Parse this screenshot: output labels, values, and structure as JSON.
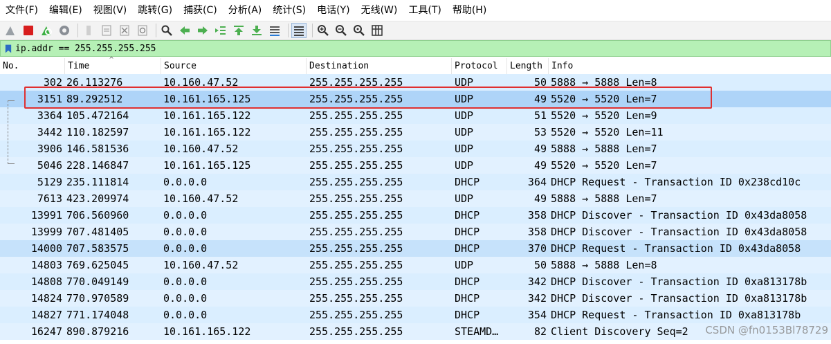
{
  "menu": [
    "文件(F)",
    "编辑(E)",
    "视图(V)",
    "跳转(G)",
    "捕获(C)",
    "分析(A)",
    "统计(S)",
    "电话(Y)",
    "无线(W)",
    "工具(T)",
    "帮助(H)"
  ],
  "toolbar": {
    "icons": [
      "shark-fin-start-icon",
      "stop-capture-icon",
      "restart-capture-icon",
      "capture-options-icon",
      "open-file-icon",
      "save-file-icon",
      "close-file-icon",
      "reload-file-icon",
      "find-packet-icon",
      "go-back-icon",
      "go-forward-icon",
      "go-to-packet-icon",
      "go-first-icon",
      "go-last-icon",
      "auto-scroll-icon",
      "colorize-icon",
      "zoom-in-icon",
      "zoom-out-icon",
      "zoom-normal-icon",
      "resize-columns-icon"
    ]
  },
  "filter": {
    "value": "ip.addr == 255.255.255.255",
    "background": "#b6f0b6"
  },
  "columns": [
    "No.",
    "Time",
    "Source",
    "Destination",
    "Protocol",
    "Length",
    "Info"
  ],
  "packets": [
    {
      "no": "302",
      "time": "26.113276",
      "src": "10.160.47.52",
      "dst": "255.255.255.255",
      "proto": "UDP",
      "len": "50",
      "info": "5888 → 5888 Len=8"
    },
    {
      "no": "3151",
      "time": "89.292512",
      "src": "10.161.165.125",
      "dst": "255.255.255.255",
      "proto": "UDP",
      "len": "49",
      "info": "5520 → 5520 Len=7"
    },
    {
      "no": "3364",
      "time": "105.472164",
      "src": "10.161.165.122",
      "dst": "255.255.255.255",
      "proto": "UDP",
      "len": "51",
      "info": "5520 → 5520 Len=9"
    },
    {
      "no": "3442",
      "time": "110.182597",
      "src": "10.161.165.122",
      "dst": "255.255.255.255",
      "proto": "UDP",
      "len": "53",
      "info": "5520 → 5520 Len=11"
    },
    {
      "no": "3906",
      "time": "146.581536",
      "src": "10.160.47.52",
      "dst": "255.255.255.255",
      "proto": "UDP",
      "len": "49",
      "info": "5888 → 5888 Len=7"
    },
    {
      "no": "5046",
      "time": "228.146847",
      "src": "10.161.165.125",
      "dst": "255.255.255.255",
      "proto": "UDP",
      "len": "49",
      "info": "5520 → 5520 Len=7"
    },
    {
      "no": "5129",
      "time": "235.111814",
      "src": "0.0.0.0",
      "dst": "255.255.255.255",
      "proto": "DHCP",
      "len": "364",
      "info": "DHCP Request  - Transaction ID 0x238cd10c"
    },
    {
      "no": "7613",
      "time": "423.209974",
      "src": "10.160.47.52",
      "dst": "255.255.255.255",
      "proto": "UDP",
      "len": "49",
      "info": "5888 → 5888 Len=7"
    },
    {
      "no": "13991",
      "time": "706.560960",
      "src": "0.0.0.0",
      "dst": "255.255.255.255",
      "proto": "DHCP",
      "len": "358",
      "info": "DHCP Discover - Transaction ID 0x43da8058"
    },
    {
      "no": "13999",
      "time": "707.481405",
      "src": "0.0.0.0",
      "dst": "255.255.255.255",
      "proto": "DHCP",
      "len": "358",
      "info": "DHCP Discover - Transaction ID 0x43da8058"
    },
    {
      "no": "14000",
      "time": "707.583575",
      "src": "0.0.0.0",
      "dst": "255.255.255.255",
      "proto": "DHCP",
      "len": "370",
      "info": "DHCP Request  - Transaction ID 0x43da8058"
    },
    {
      "no": "14803",
      "time": "769.625045",
      "src": "10.160.47.52",
      "dst": "255.255.255.255",
      "proto": "UDP",
      "len": "50",
      "info": "5888 → 5888 Len=8"
    },
    {
      "no": "14808",
      "time": "770.049149",
      "src": "0.0.0.0",
      "dst": "255.255.255.255",
      "proto": "DHCP",
      "len": "342",
      "info": "DHCP Discover - Transaction ID 0xa813178b"
    },
    {
      "no": "14824",
      "time": "770.970589",
      "src": "0.0.0.0",
      "dst": "255.255.255.255",
      "proto": "DHCP",
      "len": "342",
      "info": "DHCP Discover - Transaction ID 0xa813178b"
    },
    {
      "no": "14827",
      "time": "771.174048",
      "src": "0.0.0.0",
      "dst": "255.255.255.255",
      "proto": "DHCP",
      "len": "354",
      "info": "DHCP Request  - Transaction ID 0xa813178b"
    },
    {
      "no": "16247",
      "time": "890.879216",
      "src": "10.161.165.122",
      "dst": "255.255.255.255",
      "proto": "STEAMD…",
      "len": "82",
      "info": "Client Discovery Seq=2"
    }
  ],
  "watermark": "CSDN @fn0153Bl78729"
}
